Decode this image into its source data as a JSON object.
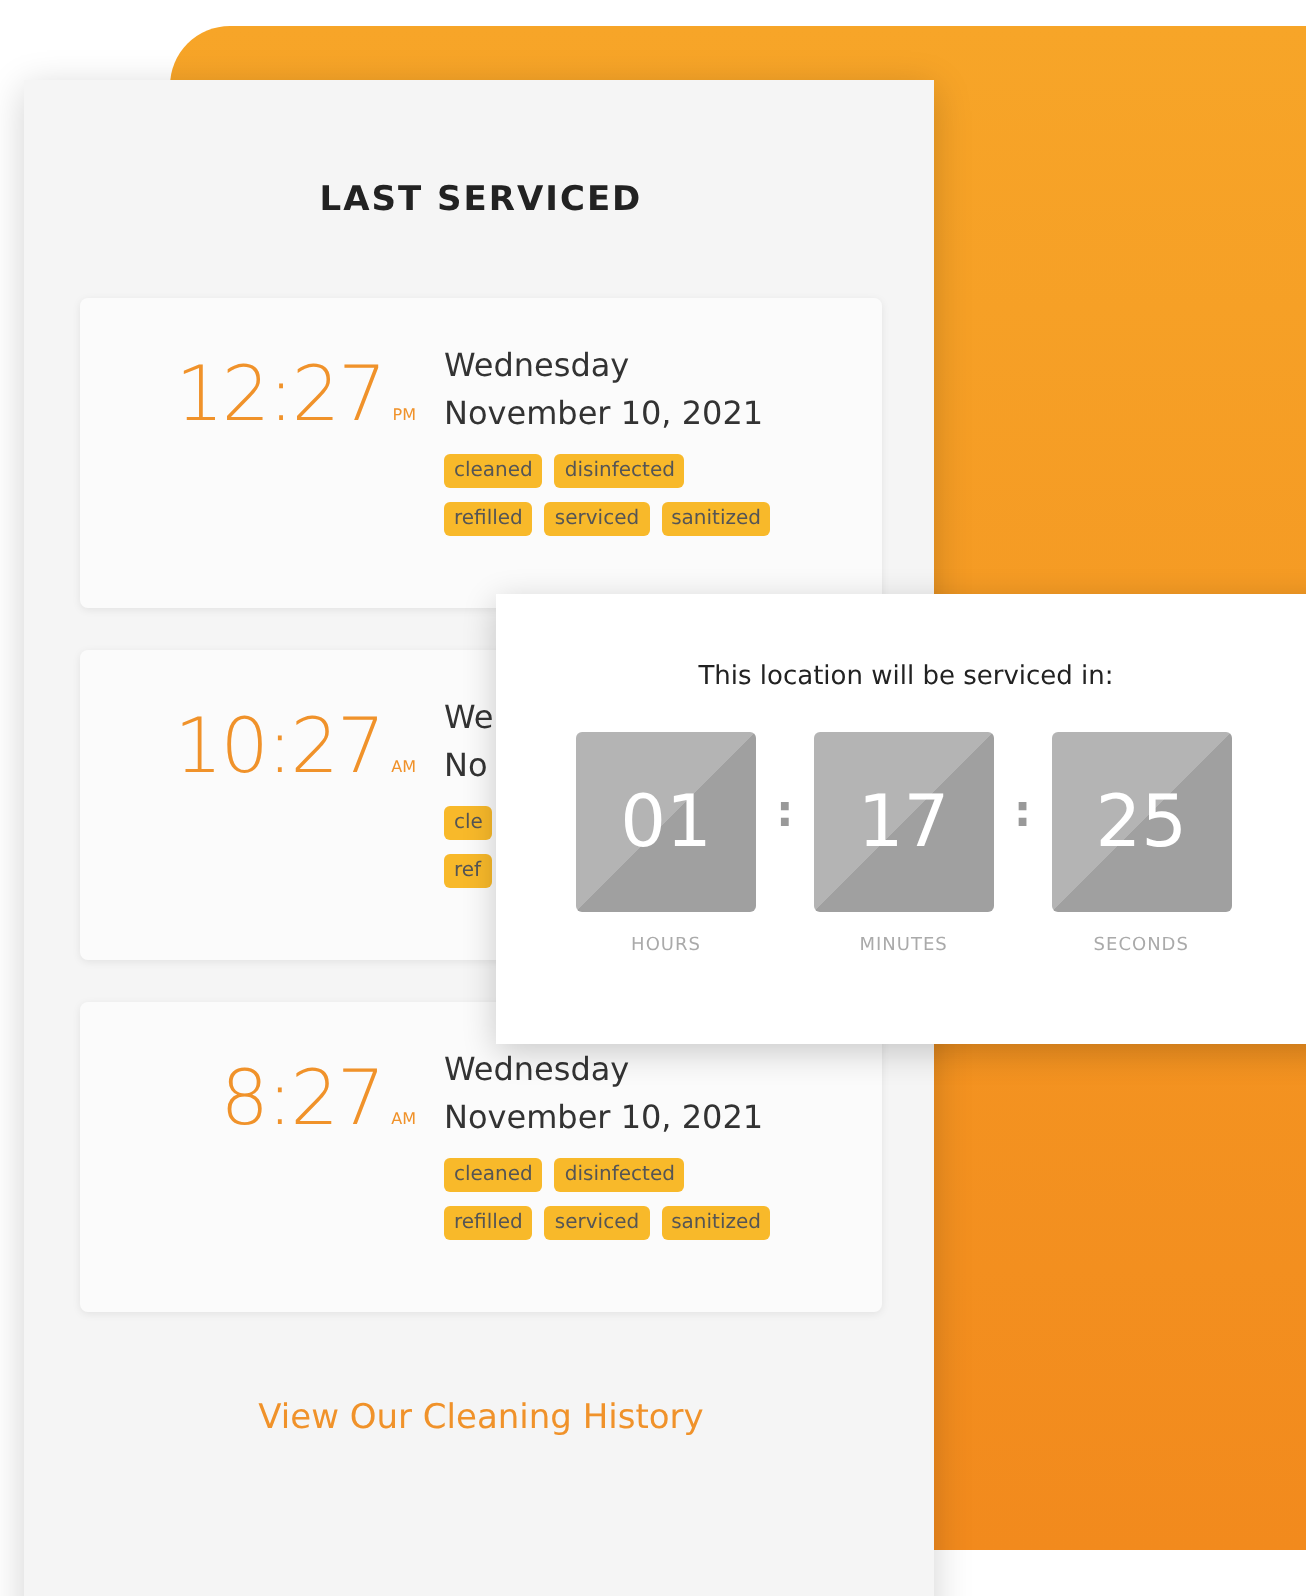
{
  "panel": {
    "title": "LAST SERVICED",
    "entries": [
      {
        "time": "12:27",
        "meridiem": "PM",
        "day": "Wednesday",
        "date": "November 10, 2021",
        "tag_rows": [
          [
            "cleaned",
            "disinfected"
          ],
          [
            "refilled",
            "serviced",
            "sanitized"
          ]
        ]
      },
      {
        "time": "10:27",
        "meridiem": "AM",
        "day": "We",
        "date": "No",
        "tag_rows": [
          [
            "cle"
          ],
          [
            "ref"
          ]
        ]
      },
      {
        "time": "8:27",
        "meridiem": "AM",
        "day": "Wednesday",
        "date": "November 10, 2021",
        "tag_rows": [
          [
            "cleaned",
            "disinfected"
          ],
          [
            "refilled",
            "serviced",
            "sanitized"
          ]
        ]
      }
    ],
    "link": "View Our Cleaning History"
  },
  "countdown": {
    "heading": "This location will be serviced in:",
    "separator": ":",
    "units": [
      {
        "value": "01",
        "label": "HOURS"
      },
      {
        "value": "17",
        "label": "MINUTES"
      },
      {
        "value": "25",
        "label": "SECONDS"
      }
    ]
  }
}
